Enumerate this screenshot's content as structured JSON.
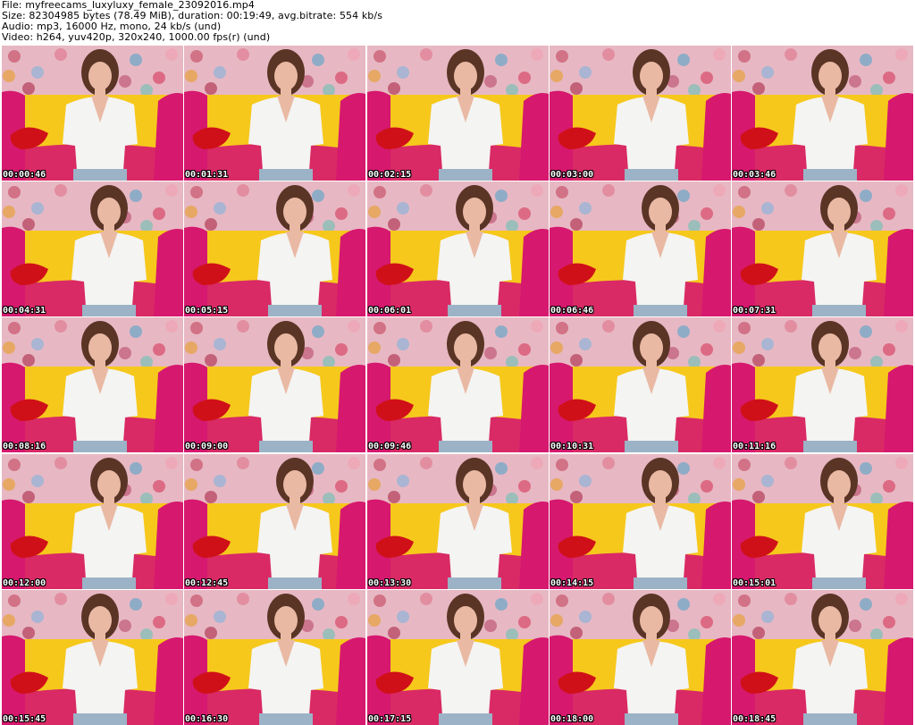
{
  "header": {
    "file": "File: myfreecams_luxyluxy_female_23092016.mp4",
    "size": "Size: 82304985 bytes (78.49 MiB), duration: 00:19:49, avg.bitrate: 554 kb/s",
    "audio": "Audio: mp3, 16000 Hz, mono, 24 kb/s (und)",
    "video": "Video: h264, yuv420p, 320x240, 1000.00 fps(r) (und)"
  },
  "frames": [
    {
      "time": "00:00:46"
    },
    {
      "time": "00:01:31"
    },
    {
      "time": "00:02:15"
    },
    {
      "time": "00:03:00"
    },
    {
      "time": "00:03:46"
    },
    {
      "time": "00:04:31"
    },
    {
      "time": "00:05:15"
    },
    {
      "time": "00:06:01"
    },
    {
      "time": "00:06:46"
    },
    {
      "time": "00:07:31"
    },
    {
      "time": "00:08:16"
    },
    {
      "time": "00:09:00"
    },
    {
      "time": "00:09:46"
    },
    {
      "time": "00:10:31"
    },
    {
      "time": "00:11:16"
    },
    {
      "time": "00:12:00"
    },
    {
      "time": "00:12:45"
    },
    {
      "time": "00:13:30"
    },
    {
      "time": "00:14:15"
    },
    {
      "time": "00:15:01"
    },
    {
      "time": "00:15:45"
    },
    {
      "time": "00:16:30"
    },
    {
      "time": "00:17:15"
    },
    {
      "time": "00:18:00"
    },
    {
      "time": "00:18:45"
    }
  ],
  "colors": {
    "wall": "#e7b8c3",
    "sofa_yellow": "#f6c81c",
    "sofa_magenta": "#d6186e",
    "pillow_red": "#d01018",
    "shirt": "#f4f4f2",
    "hair": "#5a3526",
    "skin": "#e9b9a4"
  }
}
